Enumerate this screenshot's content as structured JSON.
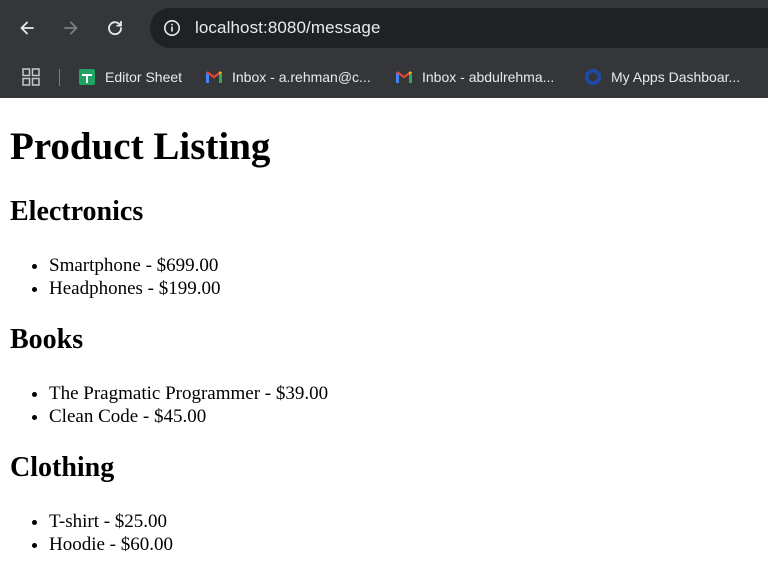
{
  "browser": {
    "url": "localhost:8080/message",
    "bookmarks": [
      {
        "label": "Editor Sheet",
        "icon": "sheets-icon"
      },
      {
        "label": "Inbox - a.rehman@c...",
        "icon": "gmail-icon"
      },
      {
        "label": "Inbox - abdulrehma...",
        "icon": "gmail-icon"
      },
      {
        "label": "My Apps Dashboar...",
        "icon": "okta-icon"
      }
    ]
  },
  "page": {
    "title": "Product Listing",
    "categories": [
      {
        "name": "Electronics",
        "items": [
          "Smartphone - $699.00",
          "Headphones - $199.00"
        ]
      },
      {
        "name": "Books",
        "items": [
          "The Pragmatic Programmer - $39.00",
          "Clean Code - $45.00"
        ]
      },
      {
        "name": "Clothing",
        "items": [
          "T-shirt - $25.00",
          "Hoodie - $60.00"
        ]
      }
    ]
  },
  "colors": {
    "chrome_bg": "#35363a",
    "omnibox_bg": "#202124",
    "chrome_text": "#e8eaed",
    "sheets_green": "#1ea362",
    "okta_blue": "#1d4aa8"
  }
}
